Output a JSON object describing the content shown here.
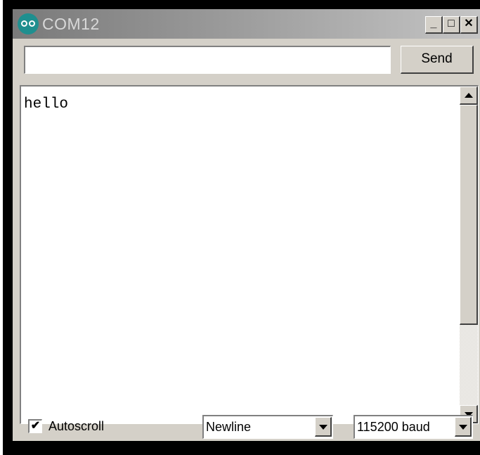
{
  "window": {
    "title": "COM12",
    "controls": {
      "minimize": "_",
      "maximize": "□",
      "close": "✕"
    }
  },
  "send_bar": {
    "input_value": "",
    "send_label": "Send"
  },
  "output": {
    "lines": [
      "hello"
    ]
  },
  "footer": {
    "autoscroll_label": "Autoscroll",
    "autoscroll_checked": "✔",
    "line_ending_value": "Newline",
    "baud_value": "115200 baud"
  },
  "icons": [
    "arduino-logo-icon",
    "scroll-up-icon",
    "scroll-down-icon",
    "dropdown-arrow-icon",
    "checkmark-icon"
  ]
}
